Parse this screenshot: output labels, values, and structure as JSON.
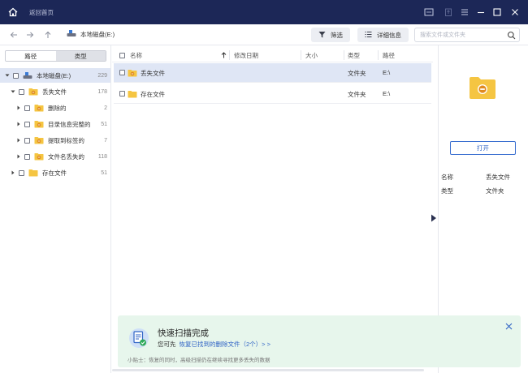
{
  "titlebar": {
    "back_home": "返回首页",
    "bg_color": "#1c2757"
  },
  "toolbar": {
    "breadcrumb": "本地磁盘(E:)",
    "filter_label": "筛选",
    "details_label": "详细信息",
    "search_placeholder": "搜索文件或文件夹"
  },
  "sidebar": {
    "tab_path": "路径",
    "tab_type": "类型",
    "tree": [
      {
        "label": "本地磁盘(E:)",
        "count": "229",
        "level": 0,
        "expanded": true,
        "icon": "drive-icon",
        "selected": true
      },
      {
        "label": "丢失文件",
        "count": "178",
        "level": 1,
        "expanded": true,
        "icon": "lost-folder-icon"
      },
      {
        "label": "删除的",
        "count": "2",
        "level": 2,
        "expanded": false,
        "icon": "lost-folder-icon"
      },
      {
        "label": "目录信息完整的",
        "count": "51",
        "level": 2,
        "expanded": false,
        "icon": "lost-folder-icon"
      },
      {
        "label": "提取到标签的",
        "count": "7",
        "level": 2,
        "expanded": false,
        "icon": "lost-folder-icon"
      },
      {
        "label": "文件名丢失的",
        "count": "118",
        "level": 2,
        "expanded": false,
        "icon": "lost-folder-icon"
      },
      {
        "label": "存在文件",
        "count": "51",
        "level": 1,
        "expanded": false,
        "icon": "folder-icon"
      }
    ]
  },
  "table": {
    "columns": {
      "name": "名称",
      "modified": "修改日期",
      "size": "大小",
      "type": "类型",
      "path": "路径"
    },
    "rows": [
      {
        "name": "丢失文件",
        "modified": "",
        "size": "",
        "type": "文件夹",
        "path": "E:\\"
      },
      {
        "name": "存在文件",
        "modified": "",
        "size": "",
        "type": "文件夹",
        "path": "E:\\"
      }
    ]
  },
  "details": {
    "open_label": "打开",
    "name_key": "名称",
    "name_value": "丢失文件",
    "type_key": "类型",
    "type_value": "文件夹"
  },
  "toast": {
    "title": "快速扫描完成",
    "hint_prefix": "您可先",
    "hint_link": "恢复已找到的删除文件（2个）> >",
    "tip": "小贴士：恢复的同时，高级扫描仍在继续寻找更多丢失的数据"
  },
  "colors": {
    "accent": "#2f63c5",
    "folder": "#f5c542",
    "toast_bg": "#e7f6ec",
    "selected_row": "#dfe6f5"
  }
}
